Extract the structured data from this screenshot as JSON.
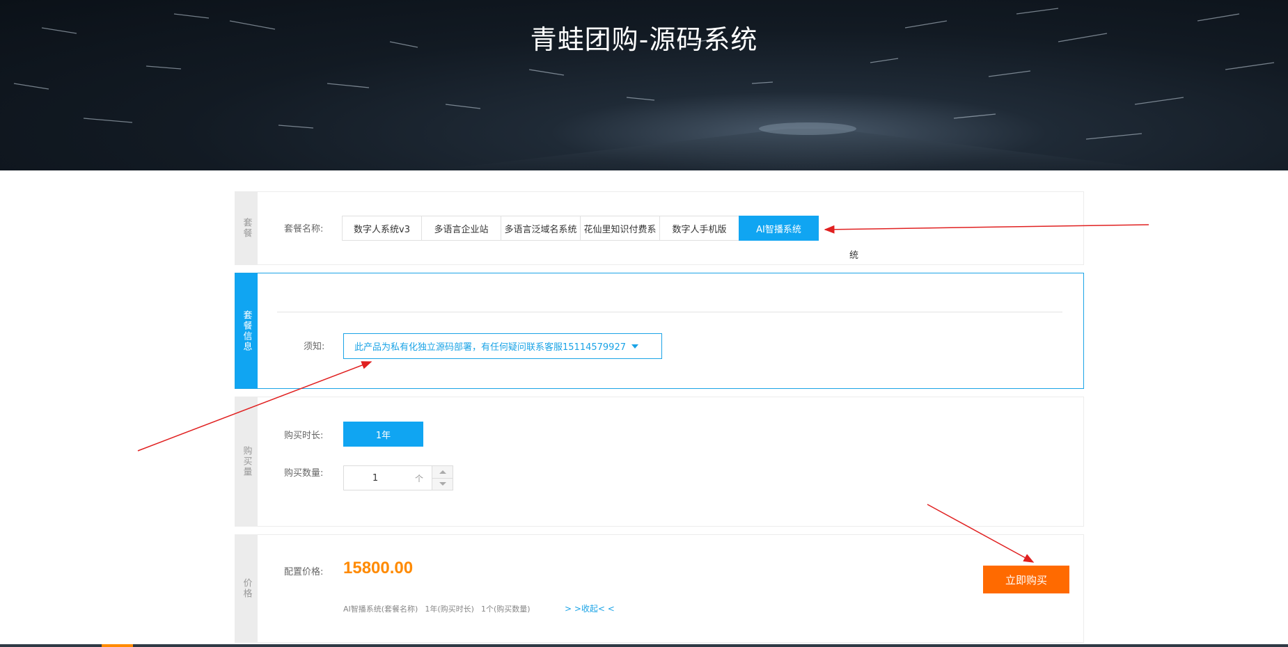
{
  "banner": {
    "title": "青蛙团购-源码系统"
  },
  "package_section": {
    "side_label": "套餐",
    "name_label": "套餐名称:",
    "tabs": [
      {
        "label": "数字人系统v3",
        "selected": false
      },
      {
        "label": "多语言企业站",
        "selected": false
      },
      {
        "label": "多语言泛域名系统",
        "selected": false
      },
      {
        "label": "花仙里知识付费系",
        "selected": false
      },
      {
        "label": "数字人手机版",
        "selected": false
      },
      {
        "label": "AI智播系统",
        "selected": true
      }
    ],
    "overflow_text": "统"
  },
  "info_section": {
    "side_label": "套餐信息",
    "notice_label": "须知:",
    "notice_value": "此产品为私有化独立源码部署，有任何疑问联系客服15114579927"
  },
  "purchase_section": {
    "side_label": "购买量",
    "duration_label": "购买时长:",
    "duration_value": "1年",
    "quantity_label": "购买数量:",
    "quantity_value": "1",
    "quantity_unit": "个"
  },
  "price_section": {
    "side_label": "价格",
    "price_label": "配置价格:",
    "price_value": "15800.00",
    "summary": [
      "AI智播系统(套餐名称)",
      "1年(购买时长)",
      "1个(购买数量)"
    ],
    "toggle_label": "> >收起< <",
    "buy_button": "立即购买"
  },
  "colors": {
    "accent": "#10a5f2",
    "price": "#ff8a00",
    "buy_button": "#ff6a00",
    "annotation_arrow": "#e02020"
  }
}
